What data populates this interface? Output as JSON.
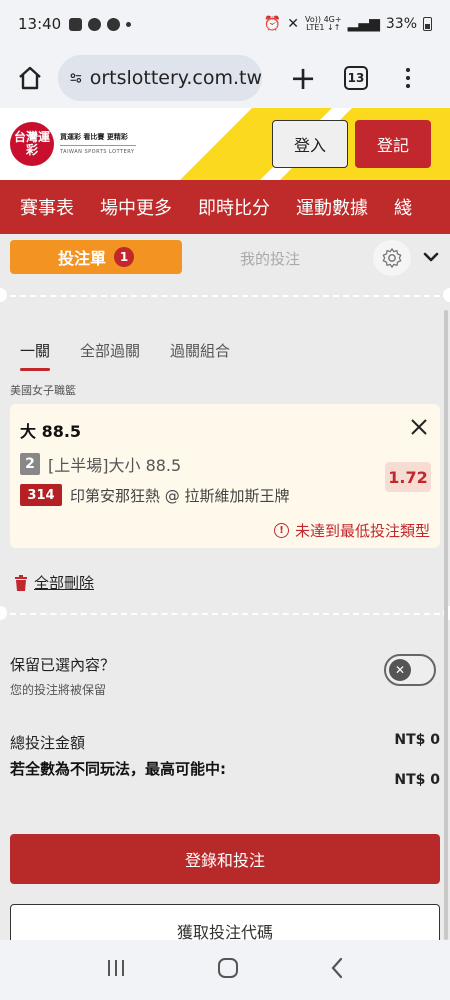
{
  "status_bar": {
    "time": "13:40",
    "network_top": "Vo)) 4G+",
    "network_bottom": "LTE1 ↓↑",
    "battery": "33%"
  },
  "browser": {
    "url": "ortslottery.com.tw",
    "tab_count": "13"
  },
  "site": {
    "logo_text": "台灣運彩",
    "tagline": "買運彩 看比賽 更精彩",
    "english_name": "TAIWAN SPORTS LOTTERY",
    "login_label": "登入",
    "register_label": "登記"
  },
  "nav": {
    "items": [
      "賽事表",
      "場中更多",
      "即時比分",
      "運動數據",
      "綫"
    ]
  },
  "betslip": {
    "slip_tab": "投注單",
    "slip_count": "1",
    "mybets_tab": "我的投注",
    "subtabs": [
      "一關",
      "全部過關",
      "過關組合"
    ],
    "league": "美國女子職籃",
    "selection": {
      "name": "大 88.5",
      "market_num": "2",
      "market": "[上半場]大小 88.5",
      "game_code": "314",
      "match": "印第安那狂熱 @ 拉斯維加斯王牌",
      "odds": "1.72",
      "warning": "未達到最低投注類型"
    },
    "delete_all": "全部刪除",
    "keep_title": "保留已選內容？",
    "keep_subtitle": "您的投注將被保留",
    "keep_enabled": false,
    "total_label": "總投注金額",
    "total_value": "NT$ 0",
    "max_win_label": "若全數為不同玩法，最高可能中:",
    "max_win_value": "NT$ 0",
    "submit_label": "登錄和投注",
    "secondary_label": "獲取投注代碼"
  },
  "colors": {
    "brand_red": "#bf2a2a",
    "accent_orange": "#f39321",
    "brand_yellow": "#fbd91f"
  }
}
